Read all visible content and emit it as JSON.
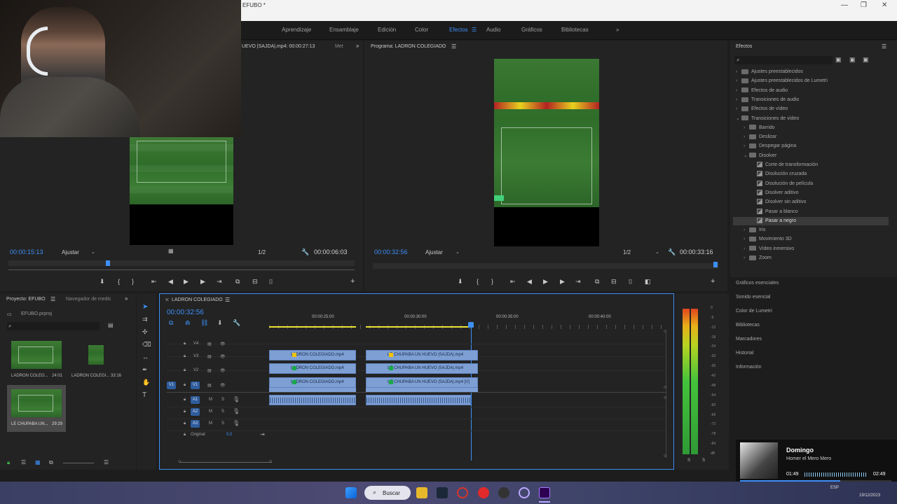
{
  "app": {
    "title": "EFUBO *"
  },
  "workspaces": [
    "Aprendizaje",
    "Ensamblaje",
    "Edición",
    "Color",
    "Efectos",
    "Audio",
    "Gráficos",
    "Bibliotecas"
  ],
  "workspace_active": "Efectos",
  "source_monitor": {
    "tab": "UEVO |SAJDA|.mp4: 00:00:27:13",
    "tab2": "Met",
    "timecode": "00:00:15:13",
    "fit": "Ajustar",
    "resolution": "1/2",
    "duration": "00:00:06:03"
  },
  "program_monitor": {
    "tab": "Programa: LADRON COLEGIADO",
    "timecode": "00:00:32:56",
    "fit": "Ajustar",
    "resolution": "1/2",
    "duration": "00:00:33:16"
  },
  "effects_panel": {
    "title": "Efectos",
    "items": [
      {
        "label": "Ajustes preestablecidos",
        "depth": 0,
        "kind": "folder"
      },
      {
        "label": "Ajustes preestablecidos de Lumetri",
        "depth": 0,
        "kind": "folder"
      },
      {
        "label": "Efectos de audio",
        "depth": 0,
        "kind": "folder"
      },
      {
        "label": "Transiciones de audio",
        "depth": 0,
        "kind": "folder"
      },
      {
        "label": "Efectos de vídeo",
        "depth": 0,
        "kind": "folder"
      },
      {
        "label": "Transiciones de vídeo",
        "depth": 0,
        "kind": "folder-open"
      },
      {
        "label": "Barrido",
        "depth": 1,
        "kind": "folder"
      },
      {
        "label": "Deslizar",
        "depth": 1,
        "kind": "folder"
      },
      {
        "label": "Despegar página",
        "depth": 1,
        "kind": "folder"
      },
      {
        "label": "Disolver",
        "depth": 1,
        "kind": "folder-open"
      },
      {
        "label": "Corte de transformación",
        "depth": 2,
        "kind": "fx"
      },
      {
        "label": "Disolución cruzada",
        "depth": 2,
        "kind": "fx"
      },
      {
        "label": "Disolución de película",
        "depth": 2,
        "kind": "fx"
      },
      {
        "label": "Disolver aditivo",
        "depth": 2,
        "kind": "fx"
      },
      {
        "label": "Disolver sin aditivo",
        "depth": 2,
        "kind": "fx"
      },
      {
        "label": "Pasar a blanco",
        "depth": 2,
        "kind": "fx"
      },
      {
        "label": "Pasar a negro",
        "depth": 2,
        "kind": "fx"
      },
      {
        "label": "Iris",
        "depth": 1,
        "kind": "folder"
      },
      {
        "label": "Movimiento 3D",
        "depth": 1,
        "kind": "folder"
      },
      {
        "label": "Vídeo inmersivo",
        "depth": 1,
        "kind": "folder"
      },
      {
        "label": "Zoom",
        "depth": 1,
        "kind": "folder"
      }
    ],
    "selected": "Pasar a negro"
  },
  "side_panels": [
    "Gráficos esenciales",
    "Sonido esencial",
    "Color de Lumetri",
    "Bibliotecas",
    "Marcadores",
    "Historial",
    "Información"
  ],
  "project_panel": {
    "tab": "Proyecto: EFUBO",
    "tab2": "Navegador de medic",
    "file": "EFUBO.prproj",
    "items": [
      {
        "name": "LADRON COLEG...",
        "duration": "24:01"
      },
      {
        "name": "LADRON COLEGI...",
        "duration": "33:16"
      },
      {
        "name": "LE CHUPABA UN...",
        "duration": "29:29"
      }
    ]
  },
  "timeline": {
    "tab": "LADRON COLEGIADO",
    "timecode": "00:00:32:56",
    "ruler": [
      "00:00:25:00",
      "00:00:30:00",
      "00:00:35:00",
      "00:00:40:00"
    ],
    "video_tracks": [
      "V4",
      "V3",
      "V2",
      "V1"
    ],
    "audio_tracks": [
      "A1",
      "A2",
      "A3"
    ],
    "source_v": "V1",
    "mix_label": "Original",
    "mix_value": "0,0",
    "clips_a": [
      "LADRON COLEGIADO.mp4",
      "LADRON COLEGIADO.mp4",
      "LADRON COLEGIADO.mp4"
    ],
    "clips_b": [
      "LE CHUPABA UN HUEVO |SAJDA|.mp4",
      "LE CHUPABA UN HUEVO |SAJDA|.mp4",
      "LE CHUPABA UN HUEVO |SAJDA|.mp4 [V]"
    ]
  },
  "meter": {
    "scale": [
      "0",
      "-6",
      "-12",
      "-18",
      "-24",
      "-30",
      "-36",
      "-42",
      "-48",
      "-54",
      "-60",
      "-66",
      "-72",
      "-78",
      "-84",
      "dB"
    ],
    "channels": [
      "S",
      "S"
    ]
  },
  "media_player": {
    "title": "Domingo",
    "artist": "Homer el Mero Mero",
    "elapsed": "01:49",
    "total": "02:49",
    "progress": 0.66
  },
  "taskbar": {
    "search": "Buscar",
    "lang": "ESP",
    "date": "19/12/2023"
  },
  "colors": {
    "accent": "#3d8ff6",
    "clip": "#7d9fd4",
    "playhead": "#3d8ff6"
  }
}
